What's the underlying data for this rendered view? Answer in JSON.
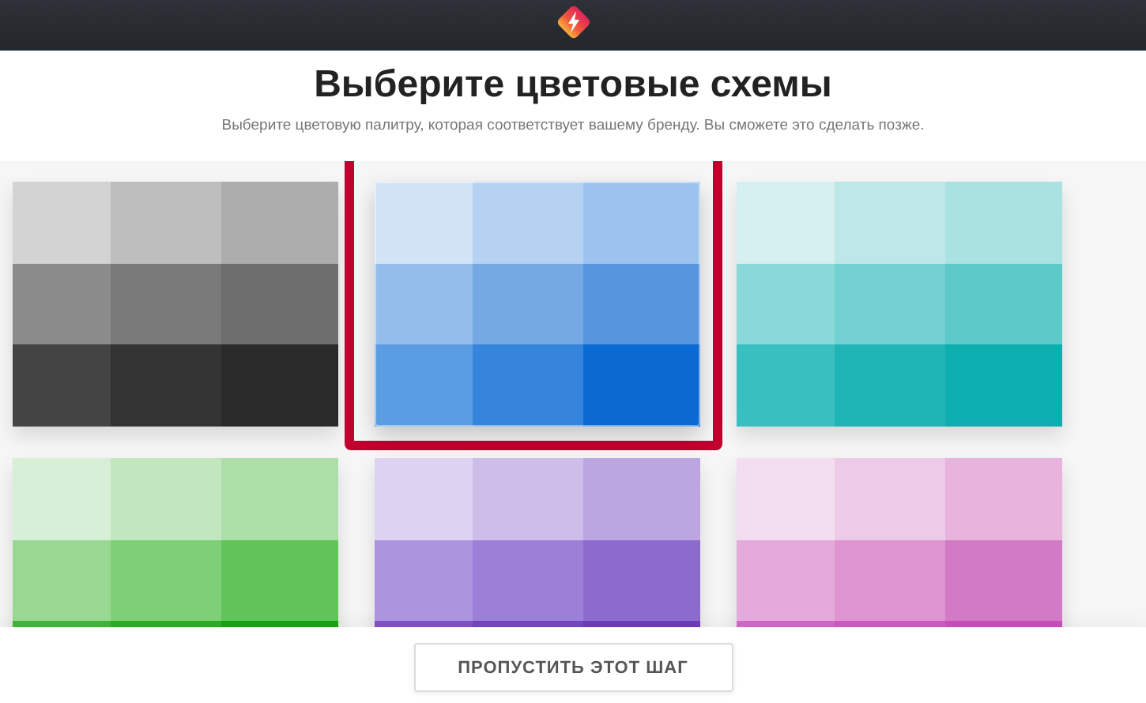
{
  "title": "Выберите цветовые схемы",
  "subtitle": "Выберите цветовую палитру, которая соответствует вашему бренду. Вы сможете это сделать позже.",
  "palettes": [
    {
      "selected": false,
      "swatches": [
        {
          "color": "#d3d3d3"
        },
        {
          "color": "#bebebe"
        },
        {
          "color": "#adadad"
        },
        {
          "color": "#8b8b8b"
        },
        {
          "color": "#7a7a7a"
        },
        {
          "color": "#6e6e6e"
        },
        {
          "color": "#444444"
        },
        {
          "color": "#333333"
        },
        {
          "color": "#2a2a2a"
        }
      ]
    },
    {
      "selected": true,
      "swatches": [
        {
          "color": "#d2e3f6"
        },
        {
          "color": "#b5d2f2"
        },
        {
          "color": "#9bc3ee"
        },
        {
          "color": "#94bdec"
        },
        {
          "color": "#74a9e4"
        },
        {
          "color": "#5696de"
        },
        {
          "color": "#5b9de2"
        },
        {
          "color": "#3585dc"
        },
        {
          "color": "#0b69d2"
        }
      ]
    },
    {
      "selected": false,
      "swatches": [
        {
          "color": "#d5f0ef"
        },
        {
          "color": "#bde8e7"
        },
        {
          "color": "#a9e2e1"
        },
        {
          "color": "#8ad8d8"
        },
        {
          "color": "#74d1d1"
        },
        {
          "color": "#5ec9c9"
        },
        {
          "color": "#3abfc0"
        },
        {
          "color": "#1fb5b6"
        },
        {
          "color": "#0caeb0"
        }
      ]
    },
    {
      "selected": false,
      "swatches": [
        {
          "color": "#d8efd7"
        },
        {
          "color": "#c2e7c0"
        },
        {
          "color": "#acdfa8"
        },
        {
          "color": "#98d892"
        },
        {
          "color": "#7ecf78"
        },
        {
          "color": "#61c45b"
        },
        {
          "color": "#3cb534"
        },
        {
          "color": "#28ad20"
        },
        {
          "color": "#16a30b"
        }
      ]
    },
    {
      "selected": false,
      "swatches": [
        {
          "color": "#ddd3f1"
        },
        {
          "color": "#cdbde8"
        },
        {
          "color": "#bba6e1"
        },
        {
          "color": "#ad94de"
        },
        {
          "color": "#9c7fd6"
        },
        {
          "color": "#8c6bcd"
        },
        {
          "color": "#8050c6"
        },
        {
          "color": "#7445c0"
        },
        {
          "color": "#6a3ab8"
        }
      ]
    },
    {
      "selected": false,
      "swatches": [
        {
          "color": "#f3ddf1"
        },
        {
          "color": "#edcae7"
        },
        {
          "color": "#e8b3dc"
        },
        {
          "color": "#e5aadc"
        },
        {
          "color": "#df94d2"
        },
        {
          "color": "#d37ac7"
        },
        {
          "color": "#d065c4"
        },
        {
          "color": "#cc58bf"
        },
        {
          "color": "#c84cb8"
        }
      ]
    }
  ],
  "skip_button": "ПРОПУСТИТЬ ЭТОТ ШАГ"
}
